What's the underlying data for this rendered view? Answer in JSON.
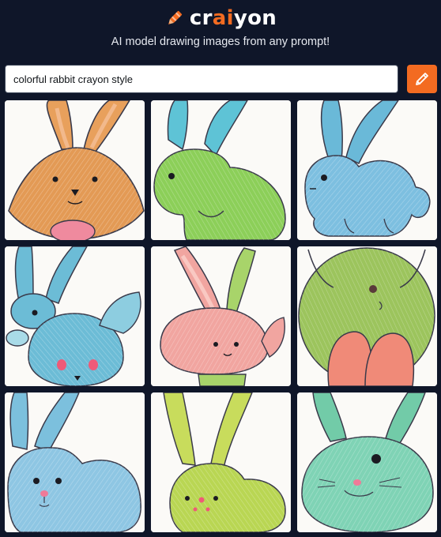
{
  "header": {
    "logo_prefix": "cr",
    "logo_accent": "ai",
    "logo_suffix": "yon",
    "tagline": "AI model drawing images from any prompt!"
  },
  "search": {
    "value": "colorful rabbit crayon style",
    "button_icon": "pencil-icon"
  },
  "colors": {
    "background": "#0f1629",
    "accent": "#f36b21"
  },
  "results": [
    {
      "subject": "orange rabbit",
      "color": "#e39a55"
    },
    {
      "subject": "green rabbit",
      "color": "#8ccf59"
    },
    {
      "subject": "blue rabbit",
      "color": "#7dbfe0"
    },
    {
      "subject": "blue rabbit",
      "color": "#6cbcd6"
    },
    {
      "subject": "pink rabbit",
      "color": "#f1a5a0"
    },
    {
      "subject": "green rabbit",
      "color": "#9cc45d"
    },
    {
      "subject": "blue rabbit",
      "color": "#8ec6e3"
    },
    {
      "subject": "yellow-green rabbit",
      "color": "#b9d653"
    },
    {
      "subject": "teal rabbit",
      "color": "#7fd3b5"
    }
  ]
}
